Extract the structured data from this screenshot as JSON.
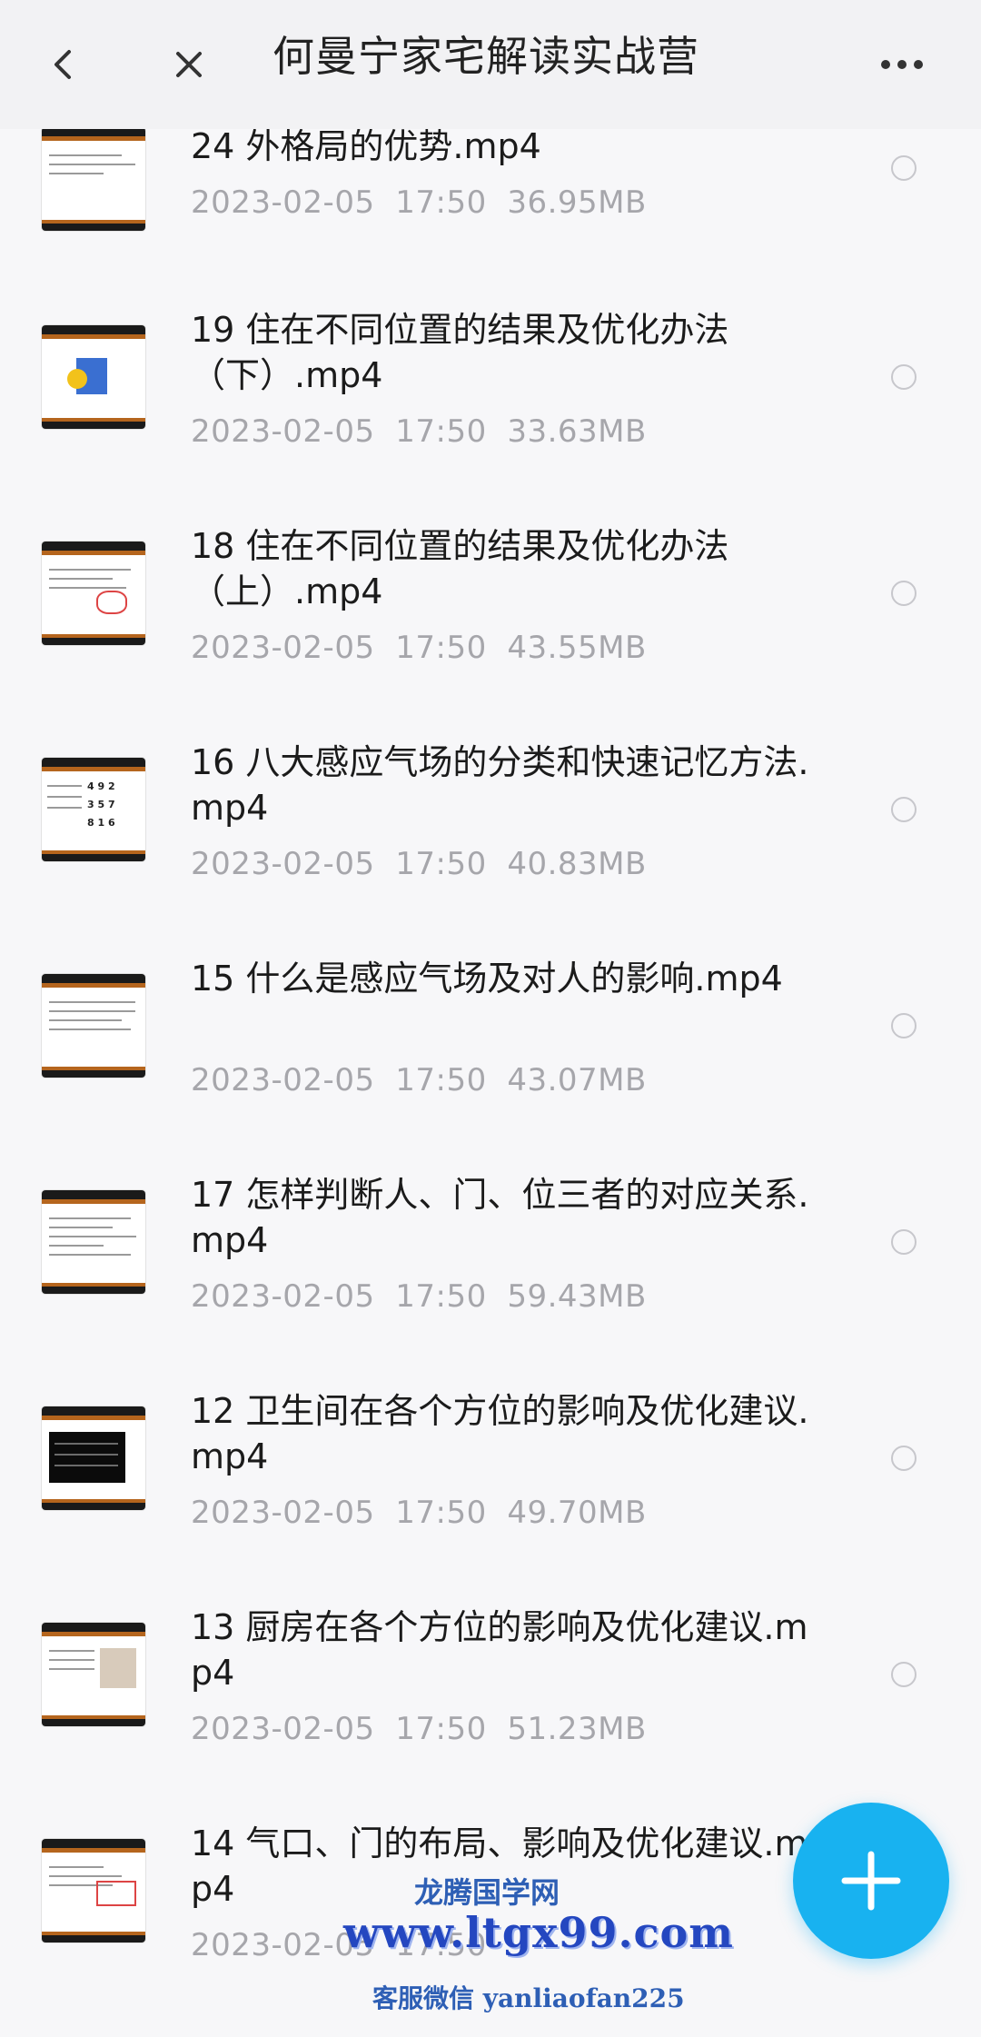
{
  "header": {
    "title": "何曼宁家宅解读实战营",
    "back_icon": "chevron-left-icon",
    "close_icon": "close-icon",
    "more_icon": "more-horizontal-icon"
  },
  "files": [
    {
      "name": "24 外格局的优势.mp4",
      "date": "2023-02-05",
      "time": "17:50",
      "size": "36.95MB"
    },
    {
      "name": "19 住在不同位置的结果及优化办法（下）.mp4",
      "date": "2023-02-05",
      "time": "17:50",
      "size": "33.63MB"
    },
    {
      "name": "18 住在不同位置的结果及优化办法（上）.mp4",
      "date": "2023-02-05",
      "time": "17:50",
      "size": "43.55MB"
    },
    {
      "name": "16 八大感应气场的分类和快速记忆方法.mp4",
      "date": "2023-02-05",
      "time": "17:50",
      "size": "40.83MB"
    },
    {
      "name": "15 什么是感应气场及对人的影响.mp4",
      "date": "2023-02-05",
      "time": "17:50",
      "size": "43.07MB"
    },
    {
      "name": "17 怎样判断人、门、位三者的对应关系.mp4",
      "date": "2023-02-05",
      "time": "17:50",
      "size": "59.43MB"
    },
    {
      "name": "12 卫生间在各个方位的影响及优化建议.mp4",
      "date": "2023-02-05",
      "time": "17:50",
      "size": "49.70MB"
    },
    {
      "name": "13 厨房在各个方位的影响及优化建议.mp4",
      "date": "2023-02-05",
      "time": "17:50",
      "size": "51.23MB"
    },
    {
      "name": "14 气口、门的布局、影响及优化建议.mp4",
      "date": "2023-02-05",
      "time": "17:50",
      "size": ""
    }
  ],
  "fab": {
    "icon": "plus-icon"
  },
  "watermark": {
    "line1": "龙腾国学网",
    "line2": "www.ltgx99.com",
    "line3": "客服微信 yanliaofan225"
  },
  "colors": {
    "accent": "#18b2f0",
    "meta": "#a6a6ab",
    "watermark": "#2447c0"
  }
}
